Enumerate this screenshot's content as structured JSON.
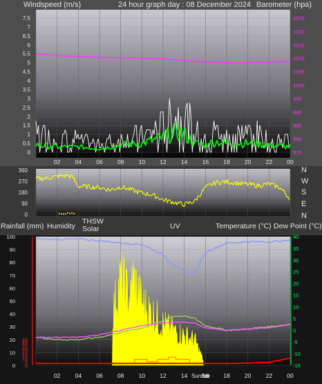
{
  "header": {
    "wind_title": "Windspeed (m/s)",
    "graph_title": "24 hour graph day : 08 December 2024",
    "baro_title": "Barometer (hpa)"
  },
  "direction_labels": [
    "N",
    "W",
    "S",
    "E",
    "N"
  ],
  "legend": {
    "rainfall": "Rainfall (mm)",
    "humidity": "Humidity",
    "thsw": "THSW",
    "solar": "Solar",
    "uv": "UV",
    "temperature": "Temperature (°C)",
    "dewpoint": "Dew Point (°C)"
  },
  "time_labels": [
    "02",
    "04",
    "06",
    "08",
    "10",
    "12",
    "14",
    "16",
    "18",
    "20",
    "22",
    "00"
  ],
  "sun_labels": {
    "rise": "Sunrise",
    "set": "Set"
  },
  "colors": {
    "barometer": "#ff33ff",
    "windspeed": "#ffffff",
    "wind_avg": "#00ff00",
    "direction": "#ffff00",
    "humidity": "#8899ff",
    "temperature": "#ff55ff",
    "dewpoint": "#99cc66",
    "solar": "#ffff00",
    "uv": "#ff8800",
    "rain": "#ff0000",
    "rain_axis": "#ff2222",
    "temp_axis": "#00ff66"
  },
  "chart_data": [
    {
      "type": "line",
      "title": "Windspeed (m/s)",
      "ylim": [
        0,
        7.5
      ],
      "yticks": [
        "0",
        "0.5",
        "1",
        "1.5",
        "2",
        "2.5",
        "3",
        "3.5",
        "4",
        "4.5",
        "5",
        "5.5",
        "6",
        "6.5",
        "7",
        "7.5"
      ],
      "y2label": "Barometer (hpa)",
      "y2lim": [
        975,
        1025
      ],
      "y2ticks": [
        "975",
        "980",
        "985",
        "990",
        "995",
        "1000",
        "1005",
        "1010",
        "1015",
        "1020",
        "1025"
      ],
      "x": [
        0,
        2,
        4,
        6,
        8,
        10,
        12,
        13,
        14,
        15,
        16,
        17,
        18,
        20,
        22,
        24
      ],
      "series": [
        {
          "name": "Barometer",
          "axis": "right",
          "values": [
            1011.6,
            1011.0,
            1010.6,
            1010.4,
            1010.2,
            1010.0,
            1009.8,
            1009.5,
            1009.2,
            1008.9,
            1008.7,
            1008.5,
            1008.4,
            1008.4,
            1008.6,
            1008.9
          ]
        },
        {
          "name": "Windspeed",
          "axis": "left",
          "values": [
            1.3,
            0.9,
            0.8,
            0.5,
            0.9,
            1.0,
            1.6,
            2.3,
            2.4,
            1.3,
            1.1,
            1.4,
            1.1,
            1.3,
            0.9,
            0.7
          ]
        },
        {
          "name": "Wind average",
          "axis": "left",
          "values": [
            0.4,
            0.3,
            0.3,
            0.2,
            0.4,
            0.5,
            0.8,
            1.1,
            1.0,
            0.5,
            0.4,
            0.6,
            0.5,
            0.5,
            0.4,
            0.3
          ]
        }
      ]
    },
    {
      "type": "scatter",
      "title": "Wind direction",
      "ylim": [
        0,
        360
      ],
      "yticks": [
        "0",
        "90",
        "180",
        "270",
        "360"
      ],
      "x": [
        0,
        1,
        2,
        3,
        3.5,
        4,
        5,
        6,
        7,
        8,
        9,
        10,
        11,
        12,
        13,
        14,
        15,
        16,
        17,
        18,
        19,
        20,
        21,
        22,
        23,
        24
      ],
      "series": [
        {
          "name": "Direction",
          "values": [
            290,
            295,
            310,
            320,
            300,
            230,
            225,
            220,
            200,
            225,
            200,
            175,
            160,
            120,
            100,
            80,
            110,
            220,
            260,
            265,
            255,
            245,
            235,
            250,
            220,
            130
          ]
        }
      ]
    },
    {
      "type": "line",
      "title": "Rainfall / Humidity / Solar / UV / Temperature / Dew Point",
      "ylim": [
        0,
        100
      ],
      "yticks": [
        "0",
        "10",
        "20",
        "30",
        "40",
        "50",
        "60",
        "70",
        "80",
        "90",
        "100"
      ],
      "rain_ticks": [
        "0",
        "5",
        "10",
        "15",
        "20",
        "25",
        "30",
        "35"
      ],
      "temp_ticks": [
        "-15",
        "-10",
        "-5",
        "0",
        "5",
        "10",
        "15",
        "20",
        "25",
        "30",
        "35",
        "40"
      ],
      "x": [
        0,
        2,
        4,
        6,
        8,
        10,
        12,
        13,
        14,
        15,
        16,
        18,
        20,
        22,
        24
      ],
      "series": [
        {
          "name": "Humidity",
          "values": [
            98,
            98,
            98,
            97,
            95,
            94,
            86,
            78,
            73,
            72,
            88,
            95,
            96,
            96,
            97
          ]
        },
        {
          "name": "Temperature",
          "values": [
            -3,
            -3,
            -3,
            -2,
            0,
            2,
            3,
            3.5,
            3.5,
            3,
            1,
            0,
            0.5,
            1,
            2.5
          ]
        },
        {
          "name": "Dew Point",
          "values": [
            -3,
            -4,
            -4,
            -3,
            -1,
            1,
            4,
            6,
            6,
            5,
            2,
            0,
            0.5,
            1.5,
            2.5
          ]
        },
        {
          "name": "Solar",
          "values": [
            0,
            0,
            0,
            0,
            88,
            45,
            30,
            25,
            22,
            18,
            0,
            0,
            0,
            0,
            0
          ]
        },
        {
          "name": "UV",
          "values": [
            0,
            0,
            0,
            0,
            0,
            0,
            1.5,
            2,
            2,
            1,
            0,
            0,
            0,
            0,
            0
          ]
        },
        {
          "name": "Rainfall",
          "values": [
            0.5,
            0.5,
            0.5,
            0.5,
            0.5,
            0.5,
            0.5,
            0.5,
            0.5,
            0.5,
            0.5,
            0.5,
            0.6,
            0.8,
            2.0
          ]
        }
      ]
    }
  ]
}
